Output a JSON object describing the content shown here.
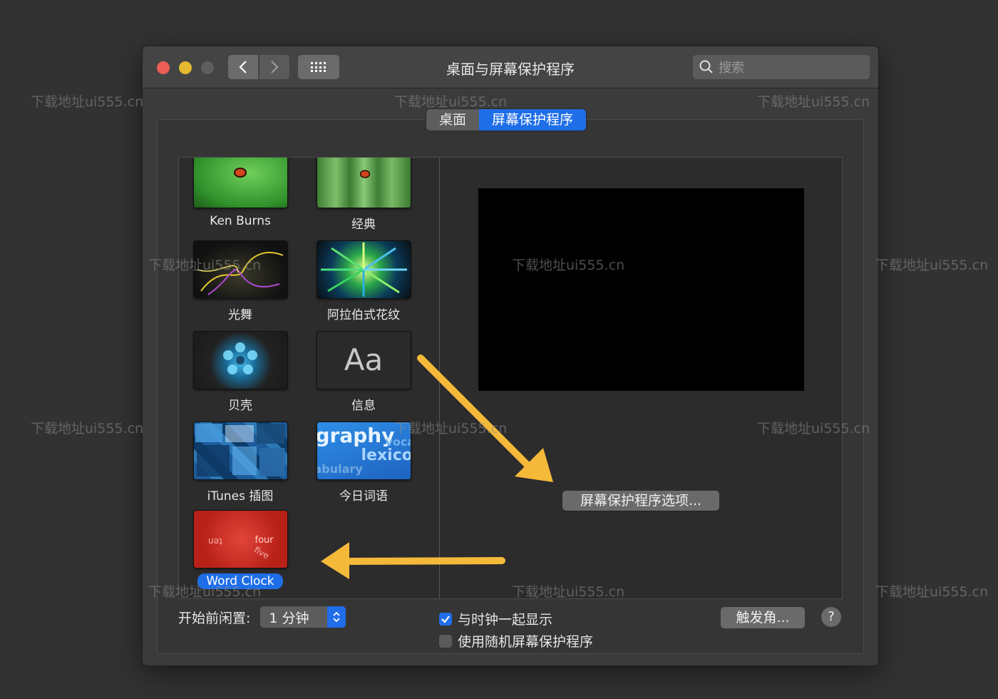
{
  "window": {
    "title": "桌面与屏幕保护程序",
    "search_placeholder": "搜索"
  },
  "tabs": [
    {
      "label": "桌面",
      "active": false
    },
    {
      "label": "屏幕保护程序",
      "active": true
    }
  ],
  "savers": [
    {
      "label": "Ken Burns",
      "selected": false
    },
    {
      "label": "经典",
      "selected": false
    },
    {
      "label": "光舞",
      "selected": false
    },
    {
      "label": "阿拉伯式花纹",
      "selected": false
    },
    {
      "label": "贝壳",
      "selected": false
    },
    {
      "label": "信息",
      "selected": false
    },
    {
      "label": "iTunes 插图",
      "selected": false
    },
    {
      "label": "今日词语",
      "selected": false
    },
    {
      "label": "Word Clock",
      "selected": true
    }
  ],
  "thumb_text": {
    "message": "Aa",
    "word_lines": [
      "graphy",
      "voca",
      "lexicog",
      "abulary"
    ],
    "clock_words": [
      "four",
      "ten",
      "five"
    ]
  },
  "preview": {
    "options_button": "屏幕保护程序选项..."
  },
  "bottom": {
    "idle_label": "开始前闲置:",
    "idle_value": "1 分钟",
    "show_clock_label": "与时钟一起显示",
    "show_clock_checked": true,
    "random_label": "使用随机屏幕保护程序",
    "random_checked": false,
    "hot_corners_button": "触发角...",
    "help_button": "?"
  },
  "watermark": "下载地址ui555.cn",
  "colors": {
    "accent": "#1f6ee8",
    "arrow": "#f5b93a",
    "close": "#ec5e57",
    "minimize": "#e3b92f"
  }
}
